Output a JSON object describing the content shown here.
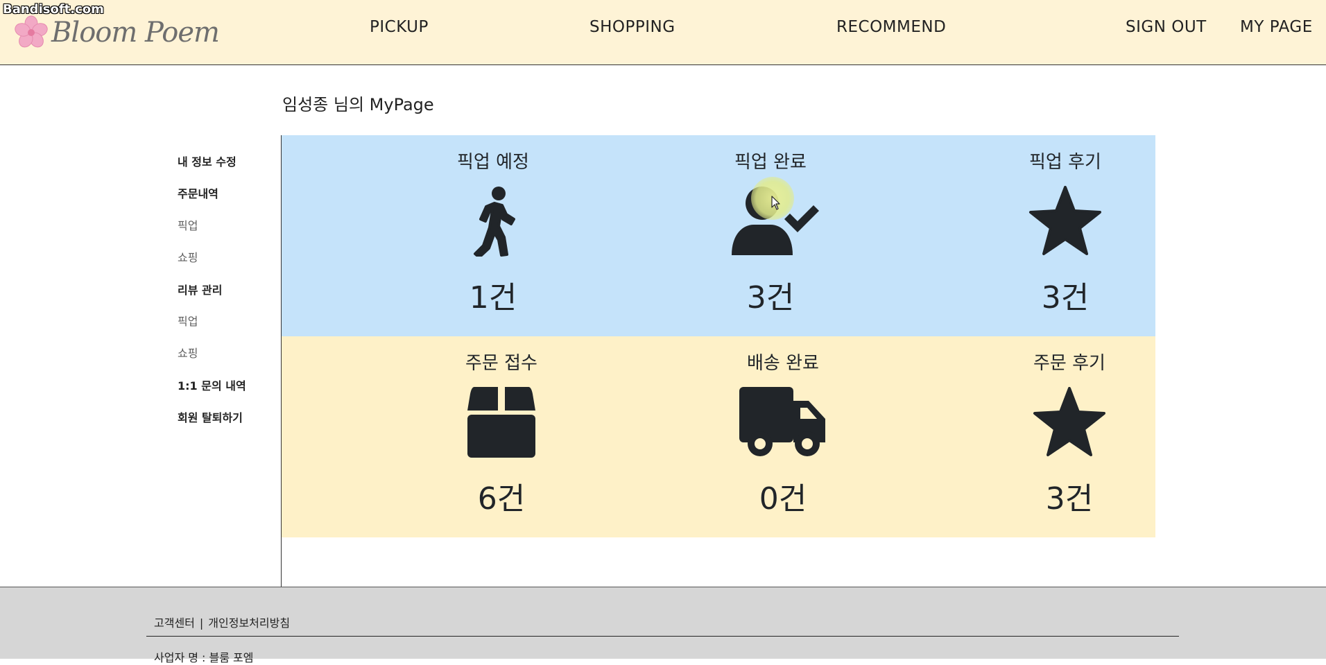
{
  "watermark": "Bandisoft.com",
  "brand": {
    "name": "Bloom Poem",
    "flower_icon": "cherry-blossom-icon",
    "flower_color": "#f2a9c5"
  },
  "nav": {
    "pickup": "PICKUP",
    "shopping": "SHOPPING",
    "recommend": "RECOMMEND",
    "sign_out": "SIGN OUT",
    "my_page": "MY PAGE"
  },
  "page_title": "임성종 님의 MyPage",
  "sidebar": {
    "edit_info": "내 정보 수정",
    "orders": "주문내역",
    "orders_pickup": "픽업",
    "orders_shopping": "쇼핑",
    "reviews": "리뷰 관리",
    "reviews_pickup": "픽업",
    "reviews_shopping": "쇼핑",
    "inquiries": "1:1 문의 내역",
    "withdraw": "회원 탈퇴하기"
  },
  "pickup_panel": {
    "bg_color": "#c5e3fa",
    "scheduled": {
      "label": "픽업 예정",
      "count": "1건",
      "icon": "person-walking-icon"
    },
    "completed": {
      "label": "픽업 완료",
      "count": "3건",
      "icon": "user-check-icon"
    },
    "review": {
      "label": "픽업 후기",
      "count": "3건",
      "icon": "star-icon"
    }
  },
  "order_panel": {
    "bg_color": "#fef1c8",
    "received": {
      "label": "주문 접수",
      "count": "6건",
      "icon": "box-icon"
    },
    "delivered": {
      "label": "배송 완료",
      "count": "0건",
      "icon": "truck-icon"
    },
    "review": {
      "label": "주문 후기",
      "count": "3건",
      "icon": "star-icon"
    }
  },
  "footer": {
    "customer_center": "고객센터",
    "separator": "|",
    "privacy_policy": "개인정보처리방침",
    "business_name": "사업자 명 : 블룸 포엠"
  },
  "colors": {
    "header_bg": "#fef3d6",
    "footer_bg": "#d6d6d6",
    "icon_color": "#212529"
  }
}
